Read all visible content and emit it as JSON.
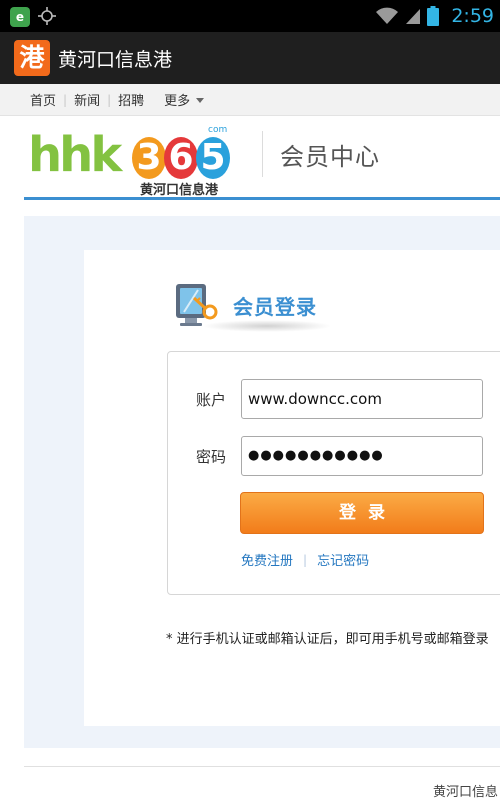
{
  "status_bar": {
    "time": "2:59",
    "notification_icon_text": "e",
    "icons": [
      "app-notification-icon",
      "gps-icon",
      "wifi-icon",
      "signal-icon",
      "battery-icon"
    ]
  },
  "app_bar": {
    "logo_text": "港",
    "title": "黄河口信息港"
  },
  "nav": {
    "items": [
      {
        "label": "首页"
      },
      {
        "label": "新闻"
      },
      {
        "label": "招聘"
      }
    ],
    "more_label": "更多"
  },
  "header": {
    "brand_text": "hhk",
    "brand_digits": [
      "3",
      "6",
      "5"
    ],
    "brand_com": "com",
    "brand_cn": "黄河口信息港",
    "title": "会员中心"
  },
  "login": {
    "title": "会员登录",
    "account_label": "账户",
    "account_value": "www.downcc.com",
    "password_label": "密码",
    "password_value": "●●●●●●●●●●●",
    "submit_label": "登录",
    "register_link": "免费注册",
    "forgot_link": "忘记密码"
  },
  "note": "* 进行手机认证或邮箱认证后，即可用手机号或邮箱登录",
  "footer": {
    "text": "黄河口信息"
  },
  "colors": {
    "accent_blue": "#3b8fd1",
    "button_orange": "#f27c1a",
    "app_logo_orange": "#f26a1b",
    "status_clock": "#33b5e5"
  }
}
